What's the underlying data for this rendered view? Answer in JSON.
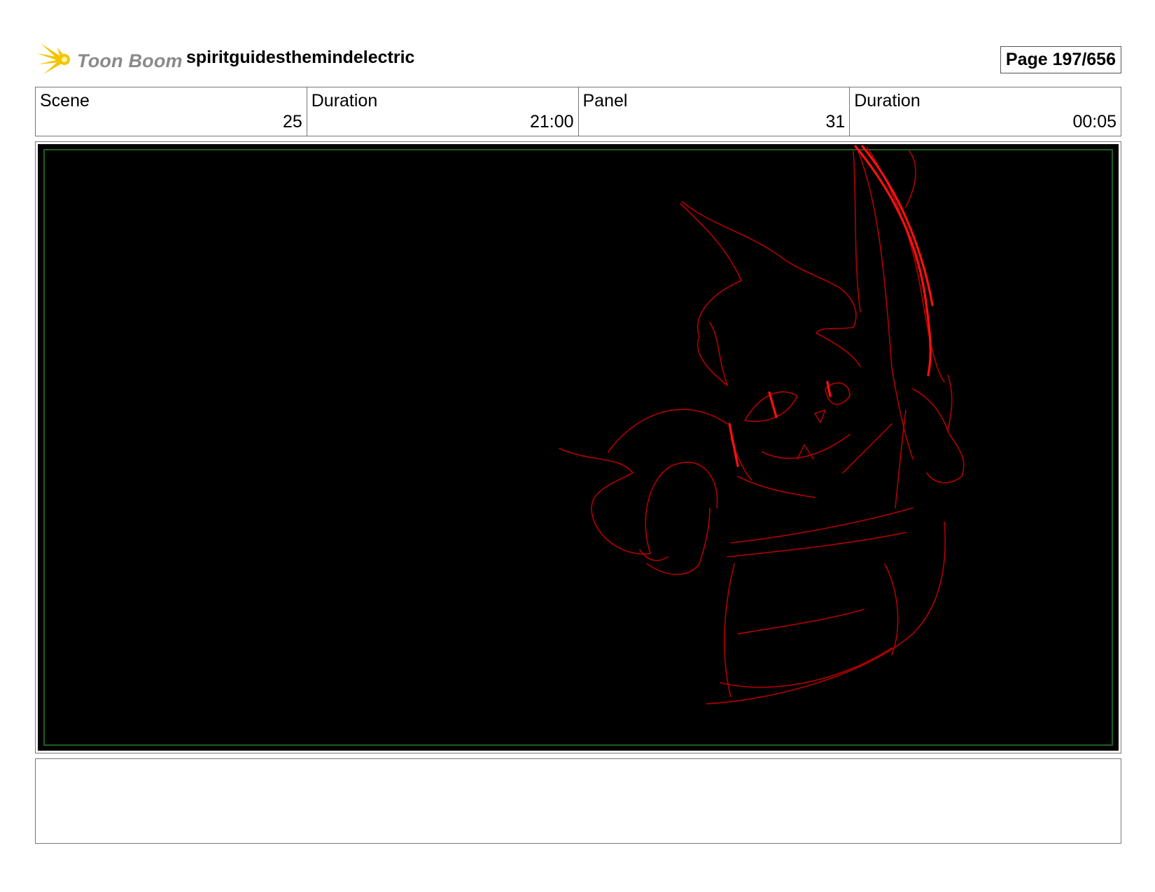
{
  "header": {
    "logo_text": "Toon Boom",
    "project_title": "spiritguidesthemindelectric",
    "page_label": "Page 197/656"
  },
  "info": {
    "scene_label": "Scene",
    "scene_value": "25",
    "scene_duration_label": "Duration",
    "scene_duration_value": "21:00",
    "panel_label": "Panel",
    "panel_value": "31",
    "panel_duration_label": "Duration",
    "panel_duration_value": "00:05"
  },
  "colors": {
    "sketch_red": "#e00000",
    "panel_background": "#000000",
    "safe_frame": "#1f5e1f",
    "logo_yellow": "#f5c400"
  },
  "icons": {
    "logo": "toon-boom-star-icon"
  }
}
